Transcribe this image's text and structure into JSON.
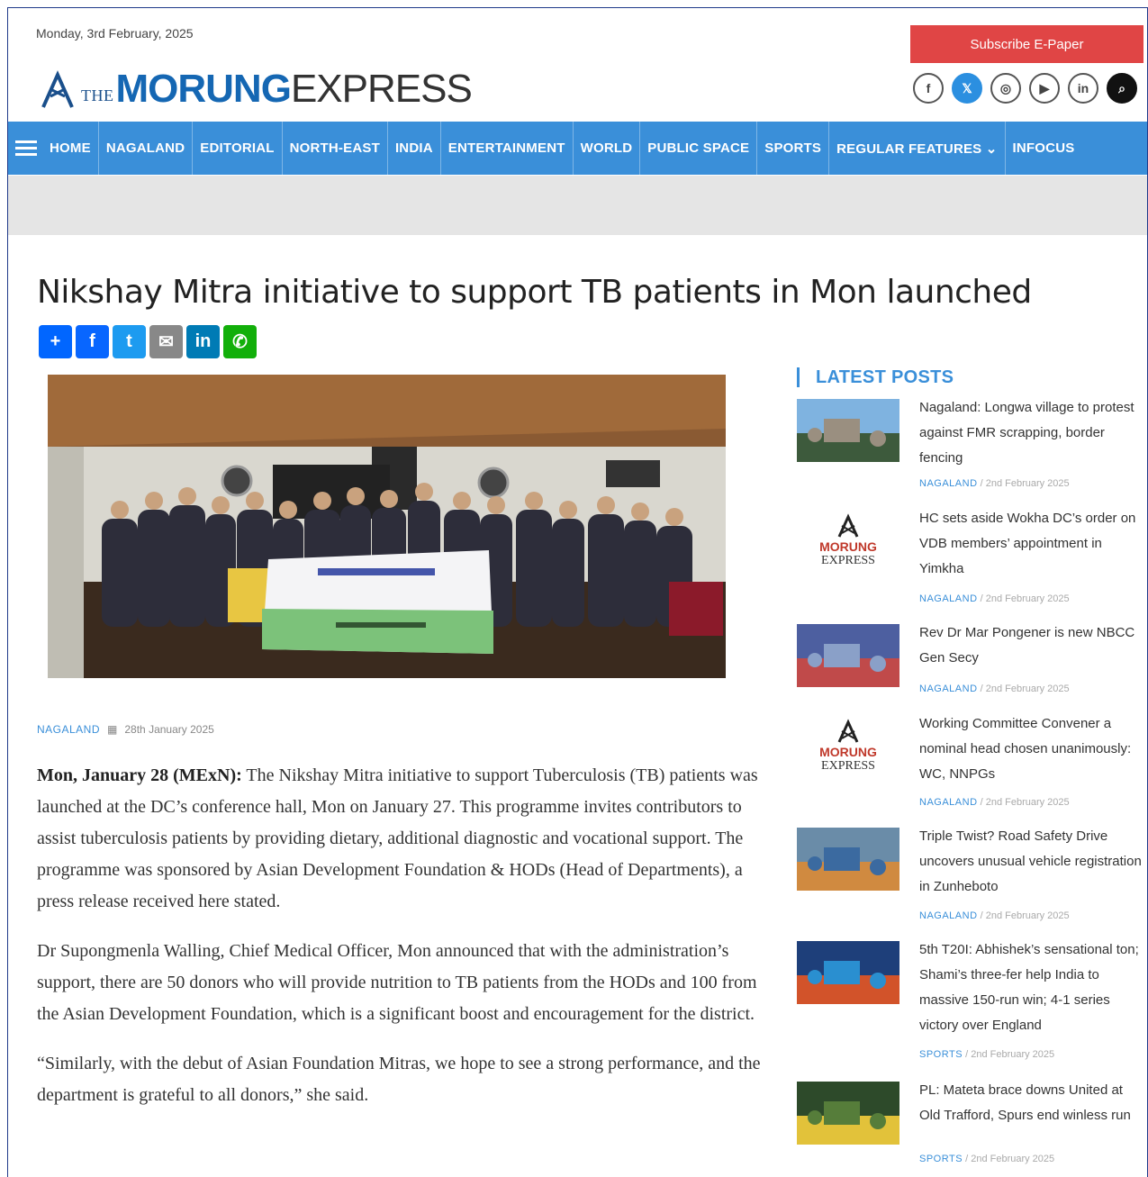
{
  "header": {
    "date": "Monday, 3rd February, 2025",
    "logo_the": "THE",
    "logo_morung": "MORUNG",
    "logo_express": "EXPRESS",
    "subscribe_label": "Subscribe E-Paper",
    "social": [
      {
        "icon": "facebook-icon",
        "glyph": "f"
      },
      {
        "icon": "twitter-icon",
        "glyph": "𝕏"
      },
      {
        "icon": "instagram-icon",
        "glyph": "◎"
      },
      {
        "icon": "youtube-icon",
        "glyph": "▶"
      },
      {
        "icon": "linkedin-icon",
        "glyph": "in"
      },
      {
        "icon": "search-icon",
        "glyph": "⌕"
      }
    ]
  },
  "nav": {
    "items": [
      "HOME",
      "NAGALAND",
      "EDITORIAL",
      "NORTH-EAST",
      "INDIA",
      "ENTERTAINMENT",
      "WORLD",
      "PUBLIC SPACE",
      "SPORTS",
      "REGULAR FEATURES ⌄",
      "INFOCUS"
    ]
  },
  "article": {
    "headline": "Nikshay Mitra initiative to support TB patients in Mon launched",
    "share": [
      {
        "icon": "add-share-icon",
        "glyph": "+",
        "color": "#0166ff"
      },
      {
        "icon": "facebook-share-icon",
        "glyph": "f",
        "color": "#0866ff"
      },
      {
        "icon": "twitter-share-icon",
        "glyph": "t",
        "color": "#1d9bf0"
      },
      {
        "icon": "email-share-icon",
        "glyph": "✉",
        "color": "#888888"
      },
      {
        "icon": "linkedin-share-icon",
        "glyph": "in",
        "color": "#007bb5"
      },
      {
        "icon": "whatsapp-share-icon",
        "glyph": "✆",
        "color": "#12af0a"
      }
    ],
    "category": "NAGALAND",
    "date": "28th January 2025",
    "lead": "Mon, January 28 (MExN):",
    "p1_rest": " The Nikshay Mitra initiative to support Tuberculosis (TB) patients was launched at the DC’s conference hall, Mon on January 27. This programme invites contributors to assist tuberculosis patients by providing dietary, additional diagnostic and vocational support. The programme was sponsored by Asian Development Foundation & HODs (Head of Departments), a press release received here stated.",
    "p2": "Dr Supongmenla Walling, Chief Medical Officer, Mon announced that with the administration’s support, there are 50 donors who will provide nutrition to TB patients from the HODs and 100 from the Asian Development Foundation, which is a significant boost and encouragement for the district.",
    "p3": "“Similarly, with the debut of Asian Foundation Mitras, we hope to see a strong performance, and the department is grateful to all donors,” she said."
  },
  "sidebar": {
    "title": "LATEST POSTS",
    "posts": [
      {
        "title": "Nagaland: Longwa village to protest against FMR scrapping, border fencing",
        "category": "NAGALAND",
        "date": "2nd February 2025",
        "thumb": "photo"
      },
      {
        "title": "HC sets aside Wokha DC’s order on VDB members’ appointment in Yimkha",
        "category": "NAGALAND",
        "date": "2nd February 2025",
        "thumb": "logo"
      },
      {
        "title": "Rev Dr Mar Pongener is new NBCC Gen Secy",
        "category": "NAGALAND",
        "date": "2nd February 2025",
        "thumb": "photo"
      },
      {
        "title": "Working Committee Convener a nominal head chosen unanimously: WC, NNPGs",
        "category": "NAGALAND",
        "date": "2nd February 2025",
        "thumb": "logo"
      },
      {
        "title": "Triple Twist? Road Safety Drive uncovers unusual vehicle registration in Zunheboto",
        "category": "NAGALAND",
        "date": "2nd February 2025",
        "thumb": "photo"
      },
      {
        "title": "5th T20I: Abhishek’s sensational ton; Shami’s three-fer help India to massive 150-run win; 4-1 series victory over England",
        "category": "SPORTS",
        "date": "2nd February 2025",
        "thumb": "photo"
      },
      {
        "title": "PL: Mateta brace downs United at Old Trafford, Spurs end winless run",
        "category": "SPORTS",
        "date": "2nd February 2025",
        "thumb": "photo"
      }
    ]
  },
  "colors": {
    "nav_blue": "#3a8fd9",
    "logo_blue": "#1567b3",
    "subscribe_red": "#e04545"
  }
}
